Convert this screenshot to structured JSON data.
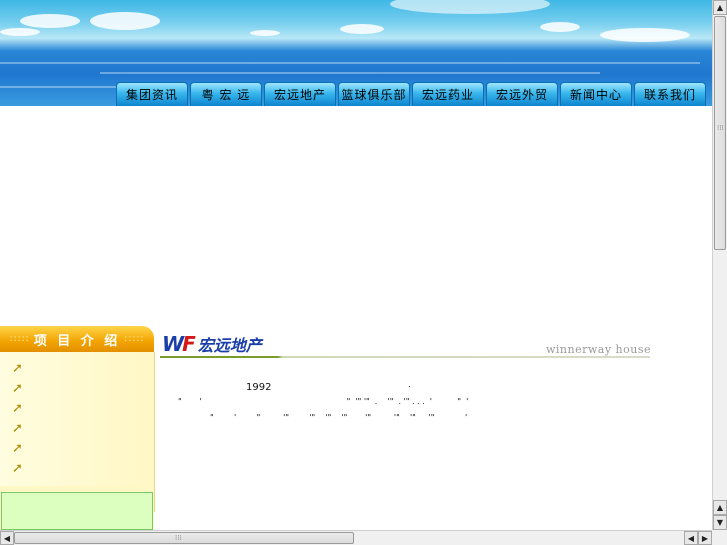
{
  "nav": {
    "items": [
      {
        "label": "集团资讯"
      },
      {
        "label": "粤 宏 远"
      },
      {
        "label": "宏远地产"
      },
      {
        "label": "篮球俱乐部"
      },
      {
        "label": "宏远药业"
      },
      {
        "label": "宏远外贸"
      },
      {
        "label": "新闻中心"
      },
      {
        "label": "联系我们"
      }
    ]
  },
  "sidebar": {
    "title": "项 目 介 绍",
    "title_dots": ":::::"
  },
  "content": {
    "logo_text": "宏远地产",
    "subtitle": "winnerway house",
    "year": "1992"
  },
  "colors": {
    "menu_blue": "#0d84cf",
    "sidebar_gold": "#f2a300",
    "logo_blue": "#1b3fa8",
    "logo_red": "#d21818",
    "green_box": "#dcffc0"
  }
}
